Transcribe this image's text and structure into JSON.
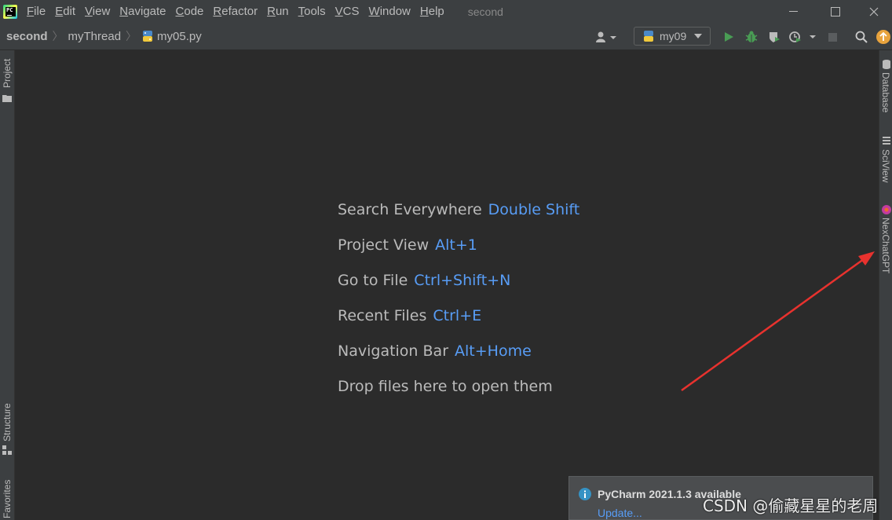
{
  "titlebar": {
    "menu": [
      {
        "mnemonic": "F",
        "rest": "ile"
      },
      {
        "mnemonic": "E",
        "rest": "dit"
      },
      {
        "mnemonic": "V",
        "rest": "iew"
      },
      {
        "mnemonic": "N",
        "rest": "avigate"
      },
      {
        "mnemonic": "C",
        "rest": "ode"
      },
      {
        "mnemonic": "R",
        "rest": "efactor"
      },
      {
        "mnemonic": "R",
        "rest": "un"
      },
      {
        "mnemonic": "T",
        "rest": "ools"
      },
      {
        "mnemonic": "V",
        "rest": "CS"
      },
      {
        "mnemonic": "W",
        "rest": "indow"
      },
      {
        "mnemonic": "H",
        "rest": "elp"
      }
    ],
    "window_title": "second"
  },
  "navbar": {
    "breadcrumbs": [
      "second",
      "myThread",
      "my05.py"
    ],
    "run_config": "my09"
  },
  "left_tool_windows": {
    "project": "Project",
    "structure": "Structure",
    "favorites": "Favorites"
  },
  "right_tool_windows": {
    "database": "Database",
    "sciview": "SciView",
    "nexchatgpt": "NexChatGPT"
  },
  "editor_hints": [
    {
      "label": "Search Everywhere",
      "shortcut": "Double Shift"
    },
    {
      "label": "Project View",
      "shortcut": "Alt+1"
    },
    {
      "label": "Go to File",
      "shortcut": "Ctrl+Shift+N"
    },
    {
      "label": "Recent Files",
      "shortcut": "Ctrl+E"
    },
    {
      "label": "Navigation Bar",
      "shortcut": "Alt+Home"
    },
    {
      "label": "Drop files here to open them",
      "shortcut": ""
    }
  ],
  "notification": {
    "title": "PyCharm 2021.1.3 available",
    "link": "Update..."
  },
  "watermark": "CSDN @偷藏星星的老周",
  "colors": {
    "background": "#2b2b2b",
    "chrome": "#3c3f41",
    "shortcut": "#589df6",
    "run_green": "#499c54",
    "annotation_arrow": "#e8322e"
  }
}
